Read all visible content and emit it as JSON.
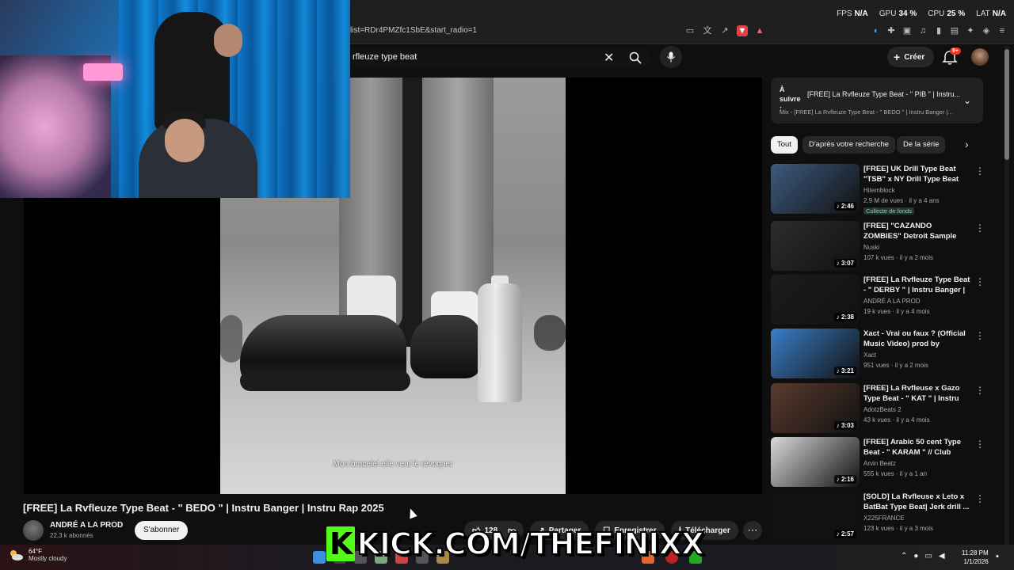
{
  "browser": {
    "url": "list=RDr4PMZfc1SbE&start_radio=1"
  },
  "stats": {
    "fps_label": "FPS",
    "fps_value": "N/A",
    "gpu_label": "GPU",
    "gpu_value": "34 %",
    "cpu_label": "CPU",
    "cpu_value": "25 %",
    "lat_label": "LAT",
    "lat_value": "N/A"
  },
  "youtube": {
    "search_query": "rfleuze type beat",
    "create_label": "Créer",
    "notif_count": "9+"
  },
  "player": {
    "subtitle": "Mon bracelet elle veut le révoquer"
  },
  "video": {
    "title": "[FREE] La Rvfleuze Type Beat - \" BEDO \" | Instru Banger | Instru Rap 2025",
    "channel": "ANDRÉ A LA PROD",
    "subscribers": "22,3 k abonnés",
    "subscribe_label": "S'abonner",
    "like_count": "128",
    "share_label": "Partager",
    "save_label": "Enregistrer",
    "download_label": "Télécharger"
  },
  "up_next": {
    "label": "À suivre :",
    "title": "[FREE] La Rvfleuze Type Beat - \" PIB \" | Instru...",
    "subtitle": "Mix - [FREE] La Rvfleuze Type Beat - \" BEDO \" | Instru Banger |..."
  },
  "chips": [
    "Tout",
    "D'après votre recherche",
    "De la série"
  ],
  "recommendations": [
    {
      "title": "[FREE] UK Drill Type Beat \"TSB\" x NY Drill Type Beat",
      "channel": "Hitemblock",
      "meta": "2,9 M de vues · il y a 4 ans",
      "duration": "2:46",
      "badge": "Collecte de fonds",
      "thumb_color": "#3d5a80"
    },
    {
      "title": "[FREE] \"CAZANDO ZOMBIES\" Detroit Sample Dark Type Beat...",
      "channel": "Nuski",
      "meta": "107 k vues · il y a 2 mois",
      "duration": "3:07",
      "badge": "",
      "thumb_color": "#2c2c2c"
    },
    {
      "title": "[FREE] La Rvfleuze Type Beat - \" DERBY \" | Instru Banger | Instr...",
      "channel": "ANDRÉ A LA PROD",
      "meta": "19 k vues · il y a 4 mois",
      "duration": "2:38",
      "badge": "",
      "thumb_color": "#1c1c1c"
    },
    {
      "title": "Xact - Vrai ou faux ? (Official Music Video) prod by flameboiii",
      "channel": "Xact",
      "meta": "951 vues · il y a 2 mois",
      "duration": "3:21",
      "badge": "",
      "thumb_color": "#3a7ec8"
    },
    {
      "title": "[FREE] La Rvfleuse x Gazo Type Beat - \" KAT \" | Instru Banger | ...",
      "channel": "AdotzBeats 2",
      "meta": "43 k vues · il y a 4 mois",
      "duration": "3:03",
      "badge": "",
      "thumb_color": "#5a3b2e"
    },
    {
      "title": "[FREE] Arabic 50 cent Type Beat - \" KARAM \" // Club Bounce Ty...",
      "channel": "Arvin Beatz",
      "meta": "555 k vues · il y a 1 an",
      "duration": "2:16",
      "badge": "",
      "thumb_color": "#d9d9d9"
    },
    {
      "title": "[SOLD] La Rvfleuse x Leto x BatBat Type Beat| Jerk drill ...",
      "channel": "X225FRANCE",
      "meta": "123 k vues · il y a 3 mois",
      "duration": "2:57",
      "badge": "",
      "thumb_color": "#111111"
    }
  ],
  "overlay": {
    "kick_k": "K",
    "kick_text": "KICK.COM/THEFINIXX"
  },
  "taskbar": {
    "temperature": "64°F",
    "weather": "Mostly cloudy",
    "time": "11:28 PM",
    "date": "1/1/2026"
  },
  "colors": {
    "accent": "#ff0000",
    "kick_green": "#53fc18"
  }
}
